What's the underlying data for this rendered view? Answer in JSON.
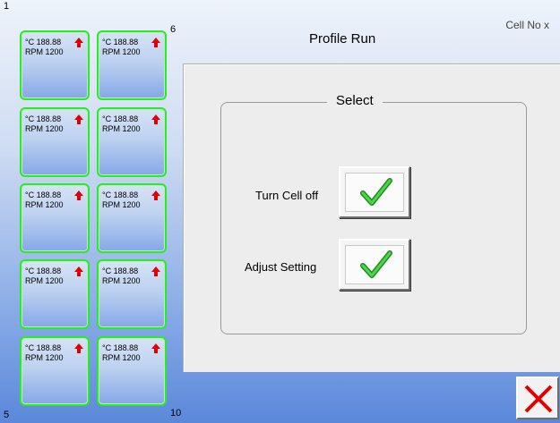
{
  "corners": {
    "tl": "1",
    "tr": "6",
    "bl": "5",
    "br": "10"
  },
  "cells": [
    {
      "temp": "°C 188.88",
      "rpm": "RPM 1200"
    },
    {
      "temp": "°C 188.88",
      "rpm": "RPM 1200"
    },
    {
      "temp": "°C 188.88",
      "rpm": "RPM 1200"
    },
    {
      "temp": "°C 188.88",
      "rpm": "RPM 1200"
    },
    {
      "temp": "°C 188.88",
      "rpm": "RPM 1200"
    },
    {
      "temp": "°C 188.88",
      "rpm": "RPM 1200"
    },
    {
      "temp": "°C 188.88",
      "rpm": "RPM 1200"
    },
    {
      "temp": "°C 188.88",
      "rpm": "RPM 1200"
    },
    {
      "temp": "°C 188.88",
      "rpm": "RPM 1200"
    },
    {
      "temp": "°C 188.88",
      "rpm": "RPM 1200"
    }
  ],
  "header": {
    "title": "Profile Run",
    "cell_no": "Cell No  x"
  },
  "select_group": {
    "legend": "Select",
    "turn_off_label": "Turn Cell off",
    "adjust_label": "Adjust Setting"
  },
  "icons": {
    "cell_status": "up-arrow-icon",
    "confirm": "checkmark-icon",
    "close": "close-x-icon"
  },
  "colors": {
    "cell_border": "#2ee82e",
    "arrow": "#e00000",
    "check": "#2ebd2e",
    "close_x": "#e00000"
  }
}
